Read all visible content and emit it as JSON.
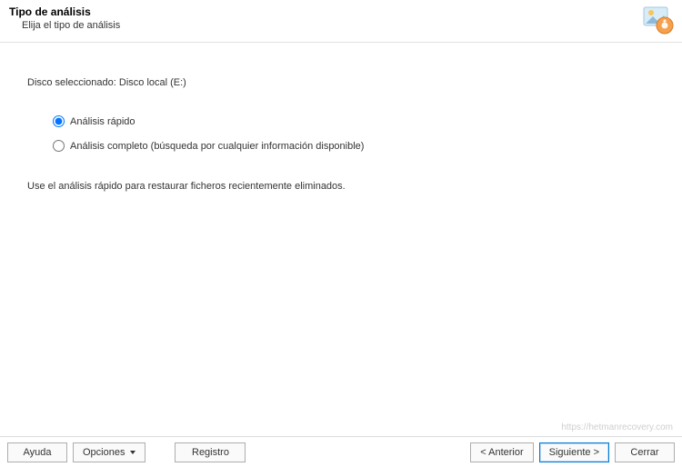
{
  "header": {
    "title": "Tipo de análisis",
    "subtitle": "Elija el tipo de análisis"
  },
  "content": {
    "disk_selected_label": "Disco seleccionado: Disco local (E:)",
    "options": {
      "quick": "Análisis rápido",
      "full": "Análisis completo (búsqueda por cualquier información disponible)"
    },
    "hint": "Use el análisis rápido para restaurar ficheros recientemente eliminados."
  },
  "footer": {
    "help": "Ayuda",
    "options": "Opciones",
    "register": "Registro",
    "back": "< Anterior",
    "next": "Siguiente >",
    "close": "Cerrar"
  },
  "watermark": "https://hetmanrecovery.com"
}
